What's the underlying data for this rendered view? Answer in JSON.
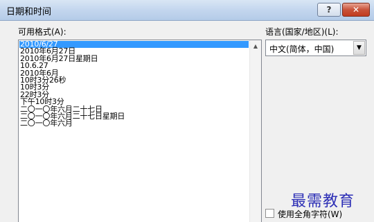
{
  "window": {
    "title": "日期和时间",
    "help_label": "?",
    "close_label": "✕"
  },
  "formats": {
    "label": "可用格式(A):",
    "items": [
      "2010/6/27",
      "2010年6月27日",
      "2010年6月27日星期日",
      "10.6.27",
      "2010年6月",
      "10时3分26秒",
      "10时3分",
      "22时3分",
      "下午10时3分",
      "二〇一〇年六月二十七日",
      "二〇一〇年六月二十七日星期日",
      "二〇一〇年六月"
    ],
    "selected_index": 0
  },
  "language": {
    "label": "语言(国家/地区)(L):",
    "selected": "中文(简体，中国)"
  },
  "fullwidth": {
    "label": "使用全角字符(W)",
    "checked": false
  },
  "watermark": "最需教育",
  "icons": {
    "scroll_up": "triangle-up",
    "dropdown": "triangle-down"
  }
}
